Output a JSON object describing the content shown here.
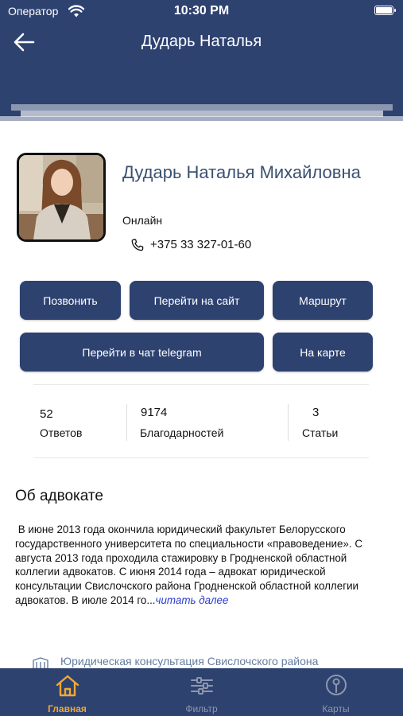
{
  "status_bar": {
    "carrier": "Оператор",
    "time": "10:30 PM"
  },
  "header": {
    "title": "Дударь Наталья"
  },
  "profile": {
    "full_name": "Дударь Наталья Михайловна",
    "status": "Онлайн",
    "phone": "+375 33 327-01-60"
  },
  "actions": {
    "call": "Позвонить",
    "website": "Перейти на сайт",
    "route": "Маршрут",
    "telegram": "Перейти в чат telegram",
    "map": "На карте"
  },
  "stats": [
    {
      "value": "52",
      "label": "Ответов"
    },
    {
      "value": "9174",
      "label": "Благодарностей"
    },
    {
      "value": "3",
      "label": "Статьи"
    }
  ],
  "about": {
    "heading": "Об адвокате",
    "text": "В июне 2013 года окончила юридический факультет Белорусского государственного университета по специальности «правоведение». С августа 2013 года проходила стажировку в Гродненской областной коллегии адвокатов. С июня 2014 года – адвокат юридической консультации Свислочского района Гродненской областной коллегии адвокатов. В июле 2014 го...",
    "read_more": "читать далее"
  },
  "office": {
    "name": "Юридическая консультация Свислочского района"
  },
  "tabs": [
    {
      "label": "Главная",
      "icon": "home-icon",
      "active": true
    },
    {
      "label": "Фильтр",
      "icon": "sliders-icon",
      "active": false
    },
    {
      "label": "Карты",
      "icon": "map-pin-icon",
      "active": false
    }
  ],
  "colors": {
    "primary": "#2e4270",
    "active_tab": "#f0a832",
    "inactive_tab": "#8e97ad",
    "link": "#2b3fd0",
    "name": "#3a5070"
  }
}
